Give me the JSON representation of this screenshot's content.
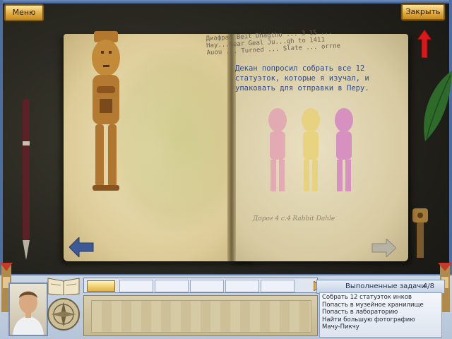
{
  "toolbar": {
    "menu_label": "Меню",
    "close_label": "Закрыть"
  },
  "journal": {
    "handwriting_lines": [
      "Диафраг Beit Dhagtho ... 3 15 ...",
      "Hay...hear Geal Ju...gh to 1411",
      "Auou ... Turned ... Slate ... orrne"
    ],
    "task_text": "Декан попросил собрать все 12 статуэток, которые я изучал, и упаковать для отправки в Перу.",
    "signature": "Дорог 4 с.4 Rabbit Dahle"
  },
  "progress": {
    "fill_fraction": 0.12
  },
  "tasks": {
    "header": "Выполненные задачи",
    "count": "4/8",
    "items": [
      "Собрать 12 статуэток инков",
      "Попасть в музейное хранилище",
      "Попасть в лабораторию",
      "Найти большую фотографию",
      "Мачу-Пикчу"
    ]
  },
  "colors": {
    "accent_gold": "#e0a93c",
    "panel_blue": "#b5c4d8",
    "handwriting_blue": "#2d4a8f",
    "hint_arrow_red": "#d8181a"
  },
  "icons": [
    "arrow-up-icon",
    "arrow-left-icon",
    "arrow-right-icon",
    "journal-icon",
    "compass-icon",
    "portrait-icon"
  ]
}
